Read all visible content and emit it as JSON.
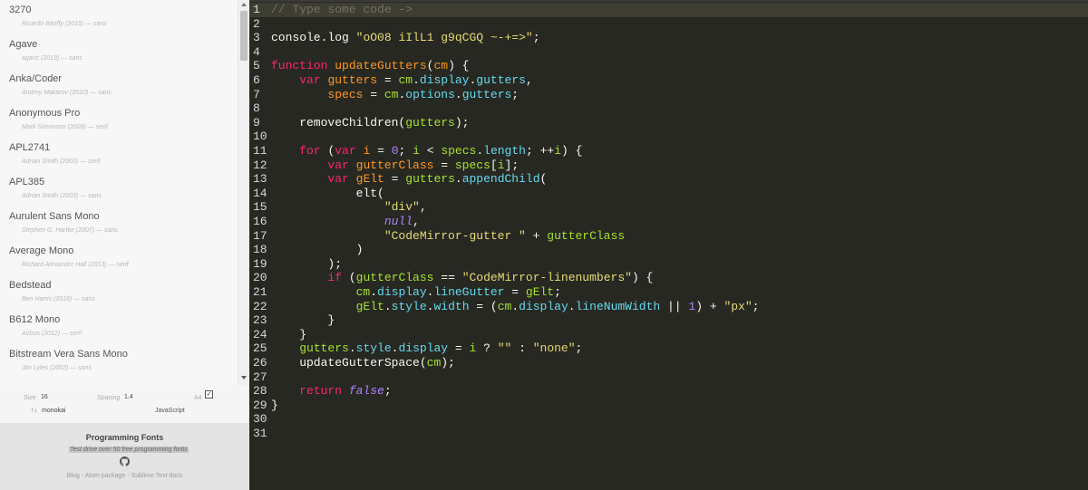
{
  "sidebar": {
    "fonts": [
      {
        "name": "3270",
        "meta": "Ricardo Bánffy (2015) — sans"
      },
      {
        "name": "Agave",
        "meta": "agaric (2013) — sans"
      },
      {
        "name": "Anka/Coder",
        "meta": "Andrey Makarov (2010) — sans"
      },
      {
        "name": "Anonymous Pro",
        "meta": "Mark Simonson (2009) — serif"
      },
      {
        "name": "APL2741",
        "meta": "Adrian Smith (2003) — serif"
      },
      {
        "name": "APL385",
        "meta": "Adrian Smith (2003) — sans"
      },
      {
        "name": "Aurulent Sans Mono",
        "meta": "Stephen G. Hartke (2007) — sans"
      },
      {
        "name": "Average Mono",
        "meta": "Richard Alexander Hall (2013) — serif"
      },
      {
        "name": "Bedstead",
        "meta": "Ben Harris (2018) — sans"
      },
      {
        "name": "B612 Mono",
        "meta": "Airbus (2012) — serif"
      },
      {
        "name": "Bitstream Vera Sans Mono",
        "meta": "Jim Lyles (2002) — sans"
      }
    ],
    "controls": {
      "size_label": "Size",
      "size_value": "16",
      "spacing_label": "Spacing",
      "spacing_value": "1.4",
      "a4_label": "A4",
      "a4_checked": "✓",
      "arrows": "↑↓",
      "theme": "monokai",
      "language": "JavaScript"
    },
    "footer": {
      "title": "Programming Fonts",
      "tagline": "Test drive over 50 free programming fonts",
      "icon": "github-icon",
      "links": [
        {
          "label": "Blog"
        },
        {
          "label": "Atom package"
        },
        {
          "label": "Sublime Text docs"
        }
      ],
      "link_separator": " - "
    }
  },
  "editor": {
    "theme_colors": {
      "background": "#272822",
      "comment": "#75715e",
      "keyword": "#f92672",
      "string": "#e6db74",
      "number": "#ae81ff",
      "def": "#fd971f",
      "variable": "#a6e22e",
      "property": "#66d9ef",
      "plain": "#f8f8f2"
    },
    "lines": [
      [
        [
          "t-comment",
          "// Type some code ->"
        ]
      ],
      [],
      [
        [
          "t-plain",
          "console"
        ],
        [
          "t-op",
          "."
        ],
        [
          "t-plain",
          "log "
        ],
        [
          "t-string",
          "\"oO08 iIlL1 g9qCGQ ~-+=>\""
        ],
        [
          "t-plain",
          ";"
        ]
      ],
      [],
      [
        [
          "t-keyword",
          "function "
        ],
        [
          "t-def",
          "updateGutters"
        ],
        [
          "t-plain",
          "("
        ],
        [
          "t-def",
          "cm"
        ],
        [
          "t-plain",
          ") {"
        ]
      ],
      [
        [
          "t-plain",
          "    "
        ],
        [
          "t-keyword",
          "var "
        ],
        [
          "t-def",
          "gutters"
        ],
        [
          "t-plain",
          " = "
        ],
        [
          "t-var",
          "cm"
        ],
        [
          "t-plain",
          "."
        ],
        [
          "t-prop",
          "display"
        ],
        [
          "t-plain",
          "."
        ],
        [
          "t-prop",
          "gutters"
        ],
        [
          "t-plain",
          ","
        ]
      ],
      [
        [
          "t-plain",
          "        "
        ],
        [
          "t-def",
          "specs"
        ],
        [
          "t-plain",
          " = "
        ],
        [
          "t-var",
          "cm"
        ],
        [
          "t-plain",
          "."
        ],
        [
          "t-prop",
          "options"
        ],
        [
          "t-plain",
          "."
        ],
        [
          "t-prop",
          "gutters"
        ],
        [
          "t-plain",
          ";"
        ]
      ],
      [],
      [
        [
          "t-plain",
          "    removeChildren("
        ],
        [
          "t-var",
          "gutters"
        ],
        [
          "t-plain",
          ");"
        ]
      ],
      [],
      [
        [
          "t-plain",
          "    "
        ],
        [
          "t-keyword",
          "for "
        ],
        [
          "t-plain",
          "("
        ],
        [
          "t-keyword",
          "var "
        ],
        [
          "t-def",
          "i"
        ],
        [
          "t-plain",
          " = "
        ],
        [
          "t-number",
          "0"
        ],
        [
          "t-plain",
          "; "
        ],
        [
          "t-var",
          "i"
        ],
        [
          "t-plain",
          " < "
        ],
        [
          "t-var",
          "specs"
        ],
        [
          "t-plain",
          "."
        ],
        [
          "t-prop",
          "length"
        ],
        [
          "t-plain",
          "; ++"
        ],
        [
          "t-var",
          "i"
        ],
        [
          "t-plain",
          ") {"
        ]
      ],
      [
        [
          "t-plain",
          "        "
        ],
        [
          "t-keyword",
          "var "
        ],
        [
          "t-def",
          "gutterClass"
        ],
        [
          "t-plain",
          " = "
        ],
        [
          "t-var",
          "specs"
        ],
        [
          "t-plain",
          "["
        ],
        [
          "t-var",
          "i"
        ],
        [
          "t-plain",
          "];"
        ]
      ],
      [
        [
          "t-plain",
          "        "
        ],
        [
          "t-keyword",
          "var "
        ],
        [
          "t-def",
          "gElt"
        ],
        [
          "t-plain",
          " = "
        ],
        [
          "t-var",
          "gutters"
        ],
        [
          "t-plain",
          "."
        ],
        [
          "t-prop",
          "appendChild"
        ],
        [
          "t-plain",
          "("
        ]
      ],
      [
        [
          "t-plain",
          "            elt("
        ]
      ],
      [
        [
          "t-plain",
          "                "
        ],
        [
          "t-string",
          "\"div\""
        ],
        [
          "t-plain",
          ","
        ]
      ],
      [
        [
          "t-plain",
          "                "
        ],
        [
          "t-atom",
          "null"
        ],
        [
          "t-plain",
          ","
        ]
      ],
      [
        [
          "t-plain",
          "                "
        ],
        [
          "t-string",
          "\"CodeMirror-gutter \""
        ],
        [
          "t-plain",
          " + "
        ],
        [
          "t-var",
          "gutterClass"
        ]
      ],
      [
        [
          "t-plain",
          "            )"
        ]
      ],
      [
        [
          "t-plain",
          "        );"
        ]
      ],
      [
        [
          "t-plain",
          "        "
        ],
        [
          "t-keyword",
          "if "
        ],
        [
          "t-plain",
          "("
        ],
        [
          "t-var",
          "gutterClass"
        ],
        [
          "t-plain",
          " == "
        ],
        [
          "t-string",
          "\"CodeMirror-linenumbers\""
        ],
        [
          "t-plain",
          ") {"
        ]
      ],
      [
        [
          "t-plain",
          "            "
        ],
        [
          "t-var",
          "cm"
        ],
        [
          "t-plain",
          "."
        ],
        [
          "t-prop",
          "display"
        ],
        [
          "t-plain",
          "."
        ],
        [
          "t-prop",
          "lineGutter"
        ],
        [
          "t-plain",
          " = "
        ],
        [
          "t-var",
          "gElt"
        ],
        [
          "t-plain",
          ";"
        ]
      ],
      [
        [
          "t-plain",
          "            "
        ],
        [
          "t-var",
          "gElt"
        ],
        [
          "t-plain",
          "."
        ],
        [
          "t-prop",
          "style"
        ],
        [
          "t-plain",
          "."
        ],
        [
          "t-prop",
          "width"
        ],
        [
          "t-plain",
          " = ("
        ],
        [
          "t-var",
          "cm"
        ],
        [
          "t-plain",
          "."
        ],
        [
          "t-prop",
          "display"
        ],
        [
          "t-plain",
          "."
        ],
        [
          "t-prop",
          "lineNumWidth"
        ],
        [
          "t-plain",
          " || "
        ],
        [
          "t-number",
          "1"
        ],
        [
          "t-plain",
          ") + "
        ],
        [
          "t-string",
          "\"px\""
        ],
        [
          "t-plain",
          ";"
        ]
      ],
      [
        [
          "t-plain",
          "        }"
        ]
      ],
      [
        [
          "t-plain",
          "    }"
        ]
      ],
      [
        [
          "t-plain",
          "    "
        ],
        [
          "t-var",
          "gutters"
        ],
        [
          "t-plain",
          "."
        ],
        [
          "t-prop",
          "style"
        ],
        [
          "t-plain",
          "."
        ],
        [
          "t-prop",
          "display"
        ],
        [
          "t-plain",
          " = "
        ],
        [
          "t-var",
          "i"
        ],
        [
          "t-plain",
          " ? "
        ],
        [
          "t-string",
          "\"\""
        ],
        [
          "t-plain",
          " : "
        ],
        [
          "t-string",
          "\"none\""
        ],
        [
          "t-plain",
          ";"
        ]
      ],
      [
        [
          "t-plain",
          "    updateGutterSpace("
        ],
        [
          "t-var",
          "cm"
        ],
        [
          "t-plain",
          ");"
        ]
      ],
      [],
      [
        [
          "t-plain",
          "    "
        ],
        [
          "t-keyword",
          "return "
        ],
        [
          "t-atom",
          "false"
        ],
        [
          "t-plain",
          ";"
        ]
      ],
      [
        [
          "t-plain",
          "}"
        ]
      ],
      [],
      []
    ]
  }
}
